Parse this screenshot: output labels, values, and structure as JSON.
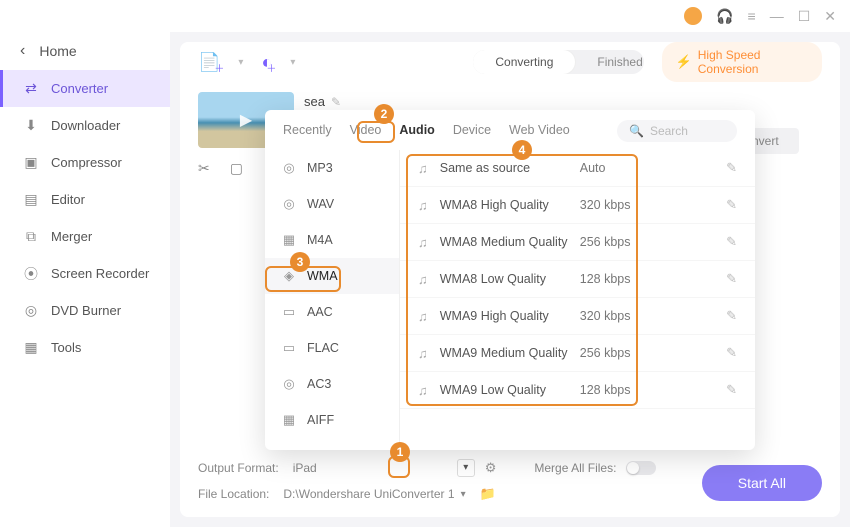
{
  "header": {
    "home": "Home"
  },
  "sidebar": {
    "items": [
      {
        "label": "Converter",
        "icon": "⇄"
      },
      {
        "label": "Downloader",
        "icon": "⬇"
      },
      {
        "label": "Compressor",
        "icon": "▣"
      },
      {
        "label": "Editor",
        "icon": "▤"
      },
      {
        "label": "Merger",
        "icon": "⧉"
      },
      {
        "label": "Screen Recorder",
        "icon": "⦿"
      },
      {
        "label": "DVD Burner",
        "icon": "◎"
      },
      {
        "label": "Tools",
        "icon": "▦"
      }
    ]
  },
  "toolbar": {
    "seg_converting": "Converting",
    "seg_finished": "Finished",
    "hsc_label": "High Speed Conversion"
  },
  "clip": {
    "name": "sea"
  },
  "convert_btn": "nvert",
  "panel": {
    "tabs": [
      "Recently",
      "Video",
      "Audio",
      "Device",
      "Web Video"
    ],
    "search_ph": "Search",
    "cats": [
      "MP3",
      "WAV",
      "M4A",
      "WMA",
      "AAC",
      "FLAC",
      "AC3",
      "AIFF"
    ],
    "presets": [
      {
        "name": "Same as source",
        "bitrate": "Auto"
      },
      {
        "name": "WMA8 High Quality",
        "bitrate": "320 kbps"
      },
      {
        "name": "WMA8 Medium Quality",
        "bitrate": "256 kbps"
      },
      {
        "name": "WMA8 Low Quality",
        "bitrate": "128 kbps"
      },
      {
        "name": "WMA9 High Quality",
        "bitrate": "320 kbps"
      },
      {
        "name": "WMA9 Medium Quality",
        "bitrate": "256 kbps"
      },
      {
        "name": "WMA9 Low Quality",
        "bitrate": "128 kbps"
      }
    ]
  },
  "bottom": {
    "output_label": "Output Format:",
    "output_value": "iPad",
    "merge_label": "Merge All Files:",
    "loc_label": "File Location:",
    "loc_value": "D:\\Wondershare UniConverter 1",
    "start_all": "Start All"
  },
  "badges": {
    "b1": "1",
    "b2": "2",
    "b3": "3",
    "b4": "4"
  }
}
